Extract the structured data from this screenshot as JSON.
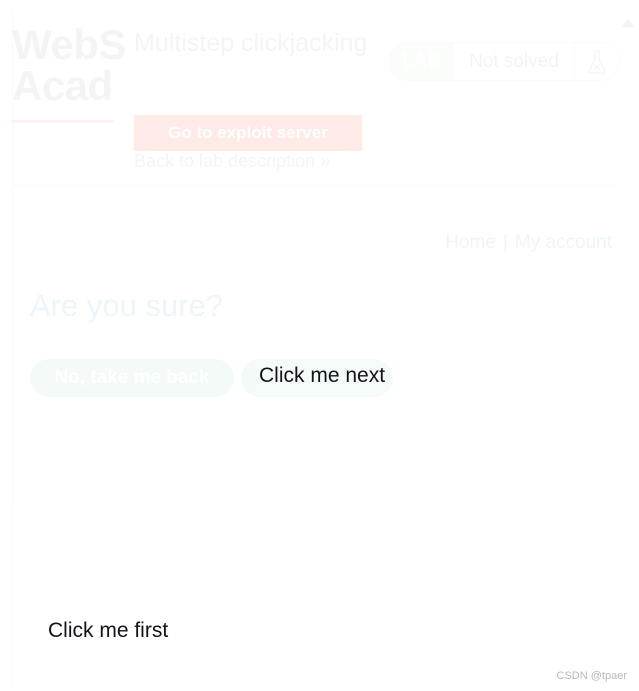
{
  "academy": {
    "logo_line1": "WebS",
    "logo_line2": "Acad",
    "lab_title": "Multistep clickjacking",
    "exploit_server_button": "Go to exploit server",
    "back_link": "Back to lab description",
    "back_link_chevron": "»"
  },
  "lab_status": {
    "tag": "LAB",
    "state": "Not solved",
    "icon": "flask-not-solved-icon",
    "tag_bg_color": "#dff0df",
    "border_color": "#cfe3cf"
  },
  "lab_app": {
    "nav": {
      "home": "Home",
      "separator": "|",
      "my_account": "My account"
    },
    "heading": "Are you sure?",
    "buttons": {
      "cancel": "No, take me back",
      "confirm": ""
    },
    "accent_color": "#5a9fd4",
    "pill_color": "#8fd6c2"
  },
  "decoys": {
    "click_me_next": "Click me next",
    "click_me_first": "Click me first"
  },
  "watermark": "CSDN @tpaer",
  "theme": {
    "exploit_button_color": "#f63c21",
    "rule_color": "#fbe2dd",
    "muted_text": "#999da1",
    "overlay_opacity": "0.10"
  }
}
